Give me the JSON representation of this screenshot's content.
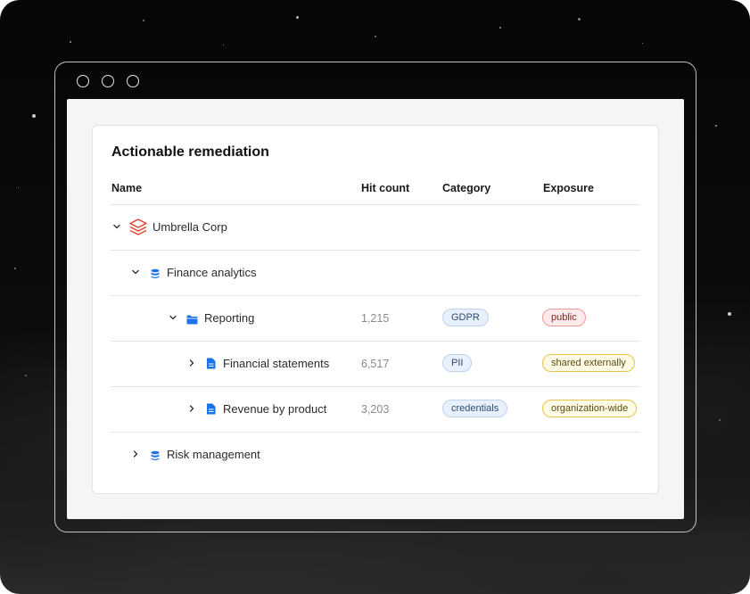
{
  "card": {
    "title": "Actionable remediation"
  },
  "table": {
    "columns": {
      "name": "Name",
      "hit_count": "Hit count",
      "category": "Category",
      "exposure": "Exposure"
    },
    "rows": [
      {
        "name": "Umbrella Corp",
        "icon": "stacked-layers-icon",
        "expanded": true,
        "hit_count": "",
        "category": "",
        "exposure": ""
      },
      {
        "name": "Finance analytics",
        "icon": "database-icon",
        "expanded": true,
        "hit_count": "",
        "category": "",
        "exposure": ""
      },
      {
        "name": "Reporting",
        "icon": "folder-icon",
        "expanded": true,
        "hit_count": "1,215",
        "category": "GDPR",
        "exposure": "public"
      },
      {
        "name": "Financial statements",
        "icon": "document-icon",
        "expanded": false,
        "hit_count": "6,517",
        "category": "PII",
        "exposure": "shared externally"
      },
      {
        "name": "Revenue by product",
        "icon": "document-icon",
        "expanded": false,
        "hit_count": "3,203",
        "category": "credentials",
        "exposure": "organization-wide"
      },
      {
        "name": "Risk management",
        "icon": "database-icon",
        "expanded": false,
        "hit_count": "",
        "category": "",
        "exposure": ""
      }
    ]
  },
  "colors": {
    "accent_blue": "#1a73e8",
    "brand_red": "#e0442f",
    "exposure_public": "#ec9a9a",
    "exposure_shared": "#e2c54a",
    "category_badge": "#bcd3ee"
  }
}
